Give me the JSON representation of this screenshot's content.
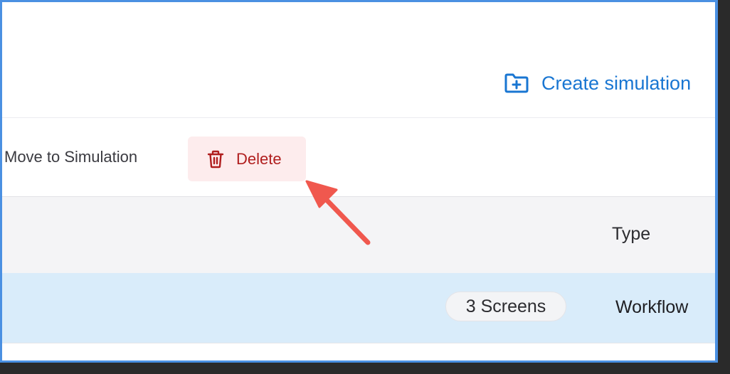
{
  "header": {
    "create_simulation_label": "Create simulation",
    "create_icon": "folder-plus-icon"
  },
  "toolbar": {
    "move_label": "Move to Simulation",
    "delete_label": "Delete",
    "delete_icon": "trash-icon"
  },
  "table": {
    "columns": [
      "Type"
    ],
    "rows": [
      {
        "screens": "3 Screens",
        "type": "Workflow"
      }
    ]
  },
  "colors": {
    "accent": "#1976d2",
    "danger": "#b01e1e",
    "danger_bg": "#fdeced",
    "row_selected": "#d9ecfa",
    "annotation_arrow": "#f0584e",
    "frame_border": "#4a90e2"
  },
  "annotation": {
    "arrow_target": "delete-button"
  }
}
